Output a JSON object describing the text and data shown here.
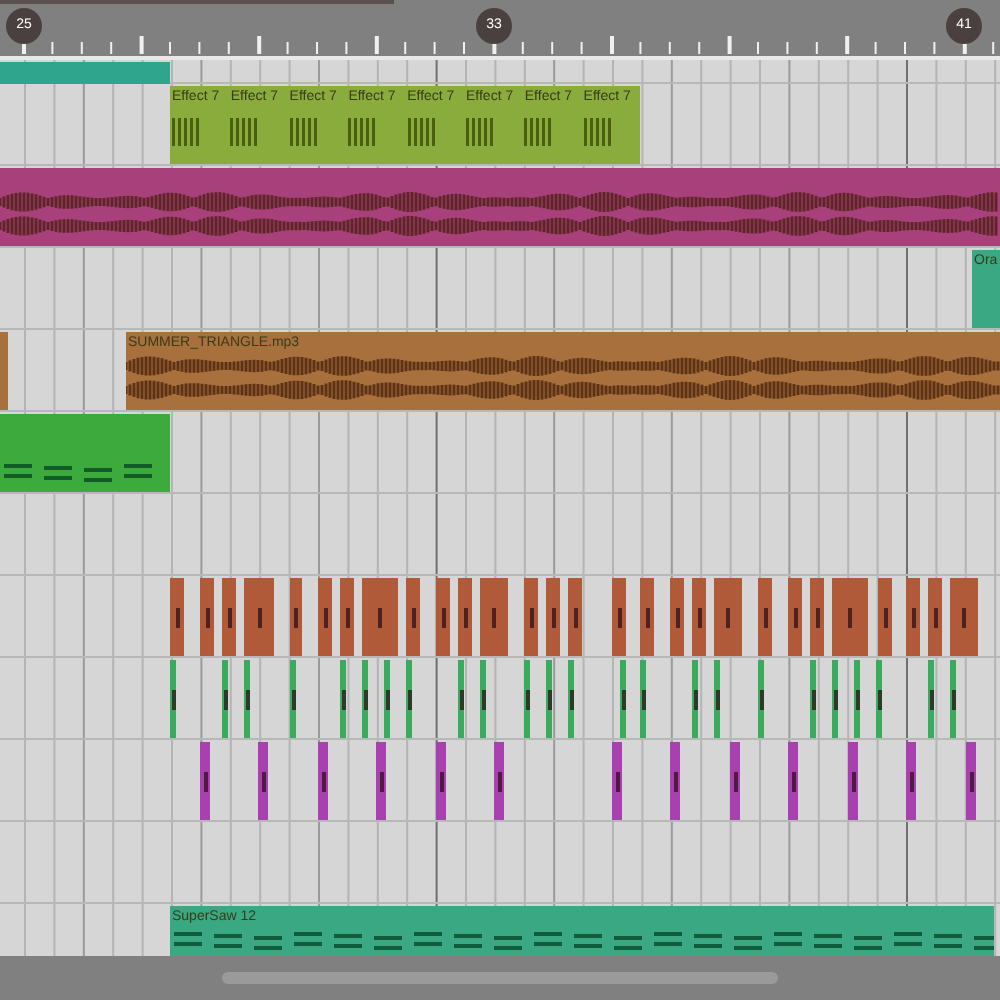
{
  "ruler": {
    "markers": [
      "25",
      "33",
      "41"
    ]
  },
  "clips": [
    {
      "kind": "midi",
      "color": "#2ea58c"
    },
    {
      "kind": "midi",
      "color": "#8aac3c",
      "name": "Effect 7"
    },
    {
      "kind": "midi",
      "color": "#8aac3c",
      "name": "Effect 7"
    },
    {
      "kind": "midi",
      "color": "#8aac3c",
      "name": "Effect 7"
    },
    {
      "kind": "midi",
      "color": "#8aac3c",
      "name": "Effect 7"
    },
    {
      "kind": "midi",
      "color": "#8aac3c",
      "name": "Effect 7"
    },
    {
      "kind": "midi",
      "color": "#8aac3c",
      "name": "Effect 7"
    },
    {
      "kind": "midi",
      "color": "#8aac3c",
      "name": "Effect 7"
    },
    {
      "kind": "midi",
      "color": "#8aac3c",
      "name": "Effect 7"
    },
    {
      "kind": "audio",
      "color": "#a8407c"
    },
    {
      "kind": "midi",
      "color": "#3aa882",
      "name": "Ora"
    },
    {
      "kind": "audio",
      "color": "#a8703c"
    },
    {
      "kind": "audio",
      "color": "#a8703c",
      "name": "SUMMER_TRIANGLE.mp3"
    },
    {
      "kind": "midi",
      "color": "#3caa3c"
    },
    {
      "kind": "midi",
      "color": "#3aa882",
      "name": "SuperSaw 12"
    }
  ],
  "hit_lanes": [
    {
      "color": "#b05a3a"
    },
    {
      "color": "#3aaa5c"
    },
    {
      "color": "#a840b0"
    }
  ]
}
